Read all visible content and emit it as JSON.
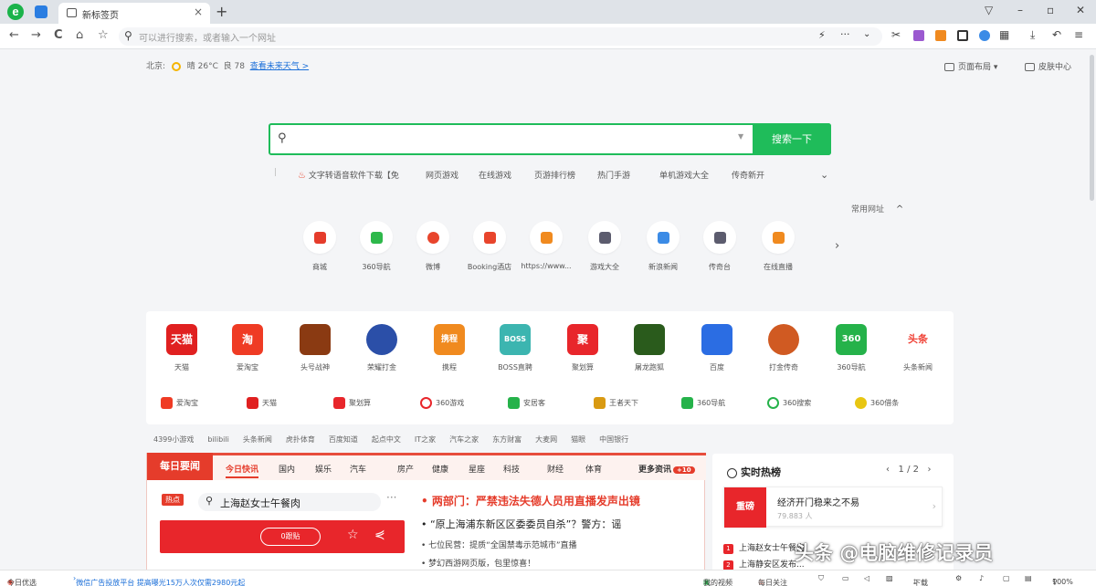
{
  "browser": {
    "tab_title": "新标签页",
    "tab_close": "×",
    "new_tab": "+",
    "address_placeholder": "可以进行搜索，或者输入一个网址",
    "nav": {
      "back": "←",
      "forward": "→",
      "reload": "C",
      "home": "⌂",
      "star": "☆"
    }
  },
  "weather": {
    "city": "北京:",
    "condition": "晴 26°C",
    "aqi": "良 78",
    "link": "查看未来天气 >"
  },
  "top_right": {
    "layout": "页面布局 ▾",
    "skin": "皮肤中心"
  },
  "search": {
    "button": "搜索一下",
    "hot_words": [
      "文字转语音软件下载【免",
      "网页游戏",
      "在线游戏",
      "页游排行榜",
      "热门手游",
      "单机游戏大全",
      "传奇新开"
    ]
  },
  "common_sites": {
    "label": "常用网址",
    "chevron": "^"
  },
  "quick_links": [
    {
      "label": "商城",
      "color": "#e53c2b"
    },
    {
      "label": "360导航",
      "color": "#2eb84b"
    },
    {
      "label": "微博",
      "color": "#e8452c"
    },
    {
      "label": "Booking酒店",
      "color": "#e8452c"
    },
    {
      "label": "https://www...",
      "color": "#f08a1f"
    },
    {
      "label": "游戏大全",
      "color": "#5c5c6e"
    },
    {
      "label": "新浪新闻",
      "color": "#3b8be6"
    },
    {
      "label": "传奇台",
      "color": "#5c5c6e"
    },
    {
      "label": "在线直播",
      "color": "#f08a1f"
    }
  ],
  "apps": [
    {
      "label": "天猫",
      "text": "天猫",
      "color": "#e02020"
    },
    {
      "label": "爱淘宝",
      "text": "淘",
      "color": "#ef3b24"
    },
    {
      "label": "头号战神",
      "text": "",
      "color": "#8a3a12"
    },
    {
      "label": "荣耀打金",
      "text": "",
      "color": "#2b4fa8"
    },
    {
      "label": "携程",
      "text": "携程",
      "color": "#f08a1f"
    },
    {
      "label": "BOSS直聘",
      "text": "BOSS",
      "color": "#3cb5b0"
    },
    {
      "label": "聚划算",
      "text": "聚",
      "color": "#e8262b"
    },
    {
      "label": "屠龙跑狐",
      "text": "",
      "color": "#2a5b1c"
    },
    {
      "label": "百度",
      "text": "",
      "color": "#2b6de3"
    },
    {
      "label": "打金传奇",
      "text": "",
      "color": "#d05a22"
    },
    {
      "label": "360导航",
      "text": "360",
      "color": "#25b24a"
    },
    {
      "label": "头条新闻",
      "text": "头条",
      "color": "#f04135"
    }
  ],
  "apps_row2": [
    {
      "label": "爱淘宝",
      "color": "#ef3b24"
    },
    {
      "label": "天猫",
      "color": "#e02020"
    },
    {
      "label": "聚划算",
      "color": "#e8262b"
    },
    {
      "label": "360游戏",
      "color": "#e8262b"
    },
    {
      "label": "安居客",
      "color": "#25b24a"
    },
    {
      "label": "王者天下",
      "color": "#d99a12"
    },
    {
      "label": "360导航",
      "color": "#25b24a"
    },
    {
      "label": "360搜索",
      "color": "#25b24a"
    },
    {
      "label": "360借条",
      "color": "#e8c612"
    }
  ],
  "text_links": [
    "4399小游戏",
    "bilibili",
    "头条新闻",
    "虎扑体育",
    "百度知道",
    "起点中文",
    "IT之家",
    "汽车之家",
    "东方财富",
    "大麦网",
    "猫眼",
    "中国银行"
  ],
  "news": {
    "brand": "每日要闻",
    "tabs": [
      "今日快讯",
      "国内",
      "娱乐",
      "汽车",
      "房产",
      "健康",
      "星座",
      "科技",
      "财经",
      "体育"
    ],
    "more": "更多资讯",
    "more_count": "+10",
    "hot_badge": "热点",
    "hot_query": "上海赵女士午餐肉",
    "hot_button": "0跟贴",
    "headline": "• 两部门：严禁违法失德人员用直播发声出镜",
    "lines": [
      "• “原上海浦东新区区委委员自杀”？警方：谣",
      "• 七位民营：提质“全国禁毒示范城市”直播",
      "• 梦幻西游网页版，包里惊喜！"
    ]
  },
  "realtime": {
    "title": "实时热榜",
    "page": "1 / 2",
    "card_tag": "重磅",
    "card_title": "经济开门稳来之不易",
    "card_count": "79.883 人",
    "items": [
      "上海赵女士午餐肉",
      "上海静安区发布..."
    ]
  },
  "status": {
    "left1": "今日优选",
    "left2": "微信广告投放平台 提高曝光15万人次仅需2980元起",
    "r1": "我的视频",
    "r2": "每日关注",
    "r3": "下载",
    "zoom": "100%"
  },
  "watermark": "头条 @电脑维修记录员"
}
